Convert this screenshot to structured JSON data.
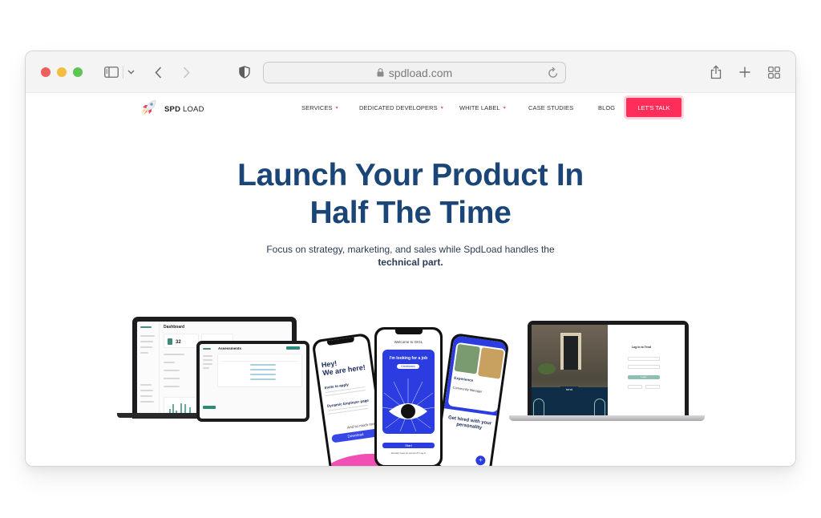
{
  "browser": {
    "url": "spdload.com",
    "icons": {
      "traffic_lights": [
        "close",
        "minimize",
        "zoom"
      ],
      "sidebar": "sidebar-icon",
      "tab_group_menu": "chevron-down-icon",
      "back": "chevron-left-icon",
      "forward": "chevron-right-icon",
      "privacy": "shield-icon",
      "lock": "lock-icon",
      "reload": "reload-icon",
      "share": "share-icon",
      "new_tab": "plus-icon",
      "tab_overview": "grid-icon"
    }
  },
  "site": {
    "logo": {
      "bold": "SPD",
      "light": "LOAD",
      "icon": "rocket-icon"
    },
    "nav": [
      {
        "label": "SERVICES",
        "dropdown": true
      },
      {
        "label": "DEDICATED DEVELOPERS",
        "dropdown": true
      },
      {
        "label": "WHITE LABEL",
        "dropdown": true
      },
      {
        "label": "CASE STUDIES",
        "dropdown": false
      },
      {
        "label": "BLOG",
        "dropdown": false
      }
    ],
    "cta_label": "LET'S TALK",
    "colors": {
      "accent": "#ff2d5a",
      "heading": "#1b4576",
      "app_blue": "#2b3de0",
      "teal": "#2e8a78"
    }
  },
  "hero": {
    "title_line1": "Launch Your Product In",
    "title_line2": "Half The Time",
    "subtitle": "Focus on strategy, marketing, and sales while SpdLoad handles the",
    "subtitle_bold": "technical part."
  },
  "mockups": {
    "dashboard": {
      "title": "Dashboard",
      "stat_value": "32"
    },
    "tablet": {
      "title": "Assessments"
    },
    "phone_left": {
      "heading1": "Hey!",
      "heading2": "We are here!",
      "item1": "Invite to apply",
      "item2": "Dynamic Employer page",
      "more": "And so much more",
      "button": "Download"
    },
    "phone_center": {
      "welcome": "Welcome to GIGL",
      "card_title": "I'm looking for a job",
      "pill": "Candidates",
      "button": "Start",
      "footer": "Already have an account? Log in"
    },
    "phone_right": {
      "section": "Experience",
      "role": "Community Manager",
      "tagline1": "Get hired with your",
      "tagline2": "personality"
    },
    "laptop_right": {
      "login_title": "Log in to Tend",
      "brand": "tend",
      "button": "Login"
    }
  }
}
